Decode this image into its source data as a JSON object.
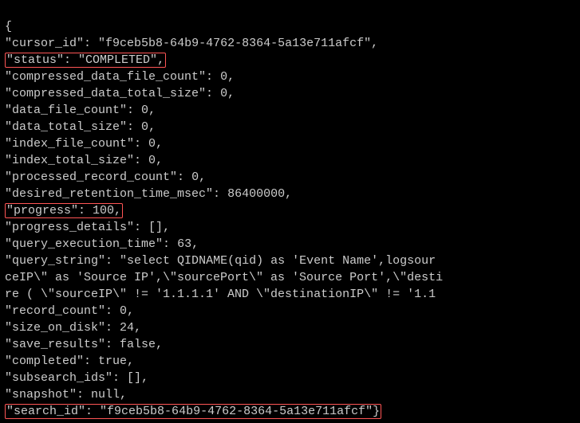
{
  "json_output": {
    "cursor_id_key": "\"cursor_id\"",
    "cursor_id_val": "\"f9ceb5b8-64b9-4762-8364-5a13e711afcf\"",
    "status_key": "\"status\"",
    "status_val": "\"COMPLETED\"",
    "compressed_data_file_count_key": "\"compressed_data_file_count\"",
    "compressed_data_file_count_val": "0",
    "compressed_data_total_size_key": "\"compressed_data_total_size\"",
    "compressed_data_total_size_val": "0",
    "data_file_count_key": "\"data_file_count\"",
    "data_file_count_val": "0",
    "data_total_size_key": "\"data_total_size\"",
    "data_total_size_val": "0",
    "index_file_count_key": "\"index_file_count\"",
    "index_file_count_val": "0",
    "index_total_size_key": "\"index_total_size\"",
    "index_total_size_val": "0",
    "processed_record_count_key": "\"processed_record_count\"",
    "processed_record_count_val": "0",
    "desired_retention_time_msec_key": "\"desired_retention_time_msec\"",
    "desired_retention_time_msec_val": "86400000",
    "progress_key": "\"progress\"",
    "progress_val": "100",
    "progress_details_key": "\"progress_details\"",
    "progress_details_val": "[]",
    "query_execution_time_key": "\"query_execution_time\"",
    "query_execution_time_val": "63",
    "query_string_key": "\"query_string\"",
    "query_string_line1": "\"select QIDNAME(qid) as 'Event Name',logsour",
    "query_string_line2": "ceIP\\\" as 'Source IP',\\\"sourcePort\\\" as 'Source Port',\\\"desti",
    "query_string_line3": "re ( \\\"sourceIP\\\" != '1.1.1.1' AND \\\"destinationIP\\\" != '1.1",
    "record_count_key": "\"record_count\"",
    "record_count_val": "0",
    "size_on_disk_key": "\"size_on_disk\"",
    "size_on_disk_val": "24",
    "save_results_key": "\"save_results\"",
    "save_results_val": "false",
    "completed_key": "\"completed\"",
    "completed_val": "true",
    "subsearch_ids_key": "\"subsearch_ids\"",
    "subsearch_ids_val": "[]",
    "snapshot_key": "\"snapshot\"",
    "snapshot_val": "null",
    "search_id_key": "\"search_id\"",
    "search_id_val": "\"f9ceb5b8-64b9-4762-8364-5a13e711afcf\""
  },
  "highlight_color": "#ff5555"
}
